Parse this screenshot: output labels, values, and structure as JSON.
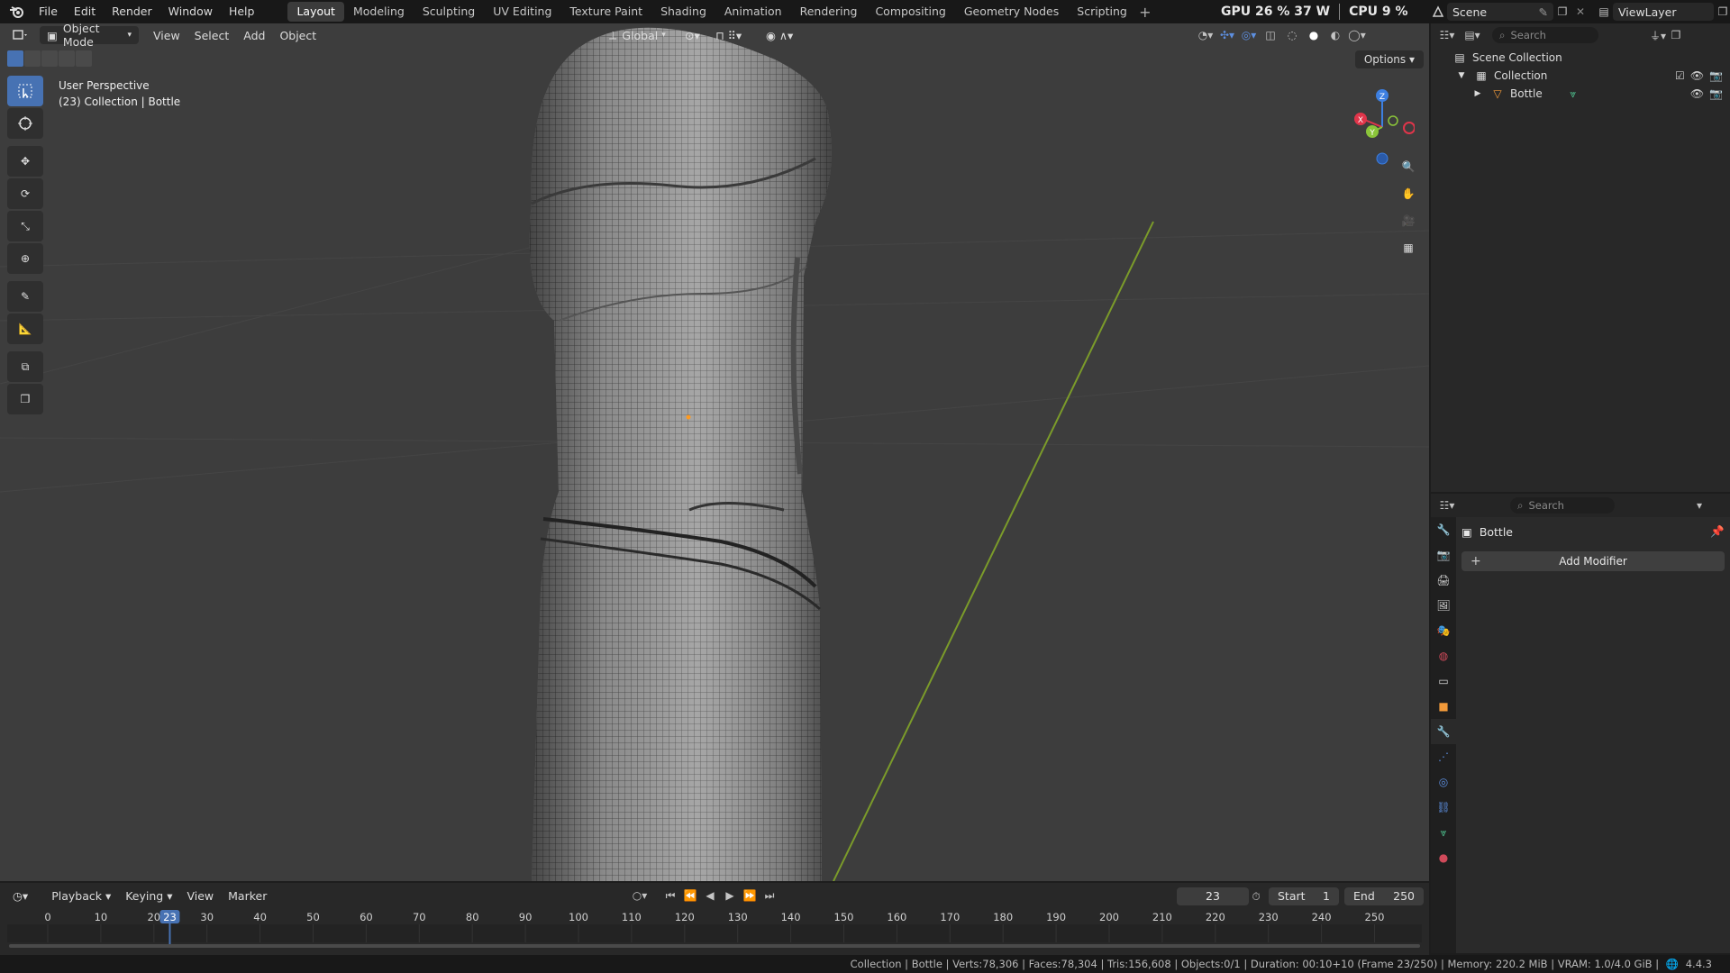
{
  "menu": {
    "items": [
      "File",
      "Edit",
      "Render",
      "Window",
      "Help"
    ]
  },
  "workspaces": {
    "tabs": [
      "Layout",
      "Modeling",
      "Sculpting",
      "UV Editing",
      "Texture Paint",
      "Shading",
      "Animation",
      "Rendering",
      "Compositing",
      "Geometry Nodes",
      "Scripting"
    ],
    "active": "Layout",
    "add": "+"
  },
  "perf": {
    "gpu": "GPU 26 % 37 W",
    "cpu": "CPU 9 %"
  },
  "scene": {
    "name": "Scene",
    "view_layer": "ViewLayer"
  },
  "viewport": {
    "mode": "Object Mode",
    "menus": [
      "View",
      "Select",
      "Add",
      "Object"
    ],
    "orientation": "Global",
    "info_line1": "User Perspective",
    "info_line2": "(23) Collection | Bottle",
    "options": "Options",
    "gizmo_axes": {
      "x": "X",
      "y": "Y",
      "z": "Z"
    }
  },
  "timeline": {
    "menus": [
      "Playback",
      "Keying",
      "View",
      "Marker"
    ],
    "current_frame": "23",
    "start_label": "Start",
    "start_value": "1",
    "end_label": "End",
    "end_value": "250",
    "ticks": [
      "0",
      "10",
      "20",
      "30",
      "40",
      "50",
      "60",
      "70",
      "80",
      "90",
      "100",
      "110",
      "120",
      "130",
      "140",
      "150",
      "160",
      "170",
      "180",
      "190",
      "200",
      "210",
      "220",
      "230",
      "240",
      "250"
    ],
    "playhead": "23"
  },
  "outliner": {
    "search_placeholder": "Search",
    "scene_collection": "Scene Collection",
    "collection": "Collection",
    "object": "Bottle"
  },
  "properties": {
    "search_placeholder": "Search",
    "object_name": "Bottle",
    "add_modifier": "Add Modifier"
  },
  "statusbar": {
    "text": "Collection | Bottle | Verts:78,306 | Faces:78,304 | Tris:156,608 | Objects:0/1 | Duration: 00:10+10 (Frame 23/250) | Memory: 220.2 MiB | VRAM: 1.0/4.0 GiB |",
    "version": "4.4.3"
  },
  "colors": {
    "accent": "#4772b3",
    "axis_x": "#e0354a",
    "axis_y": "#8bc53a",
    "axis_z": "#3d7fe0",
    "y_axis_line": "#7b9b2a"
  }
}
